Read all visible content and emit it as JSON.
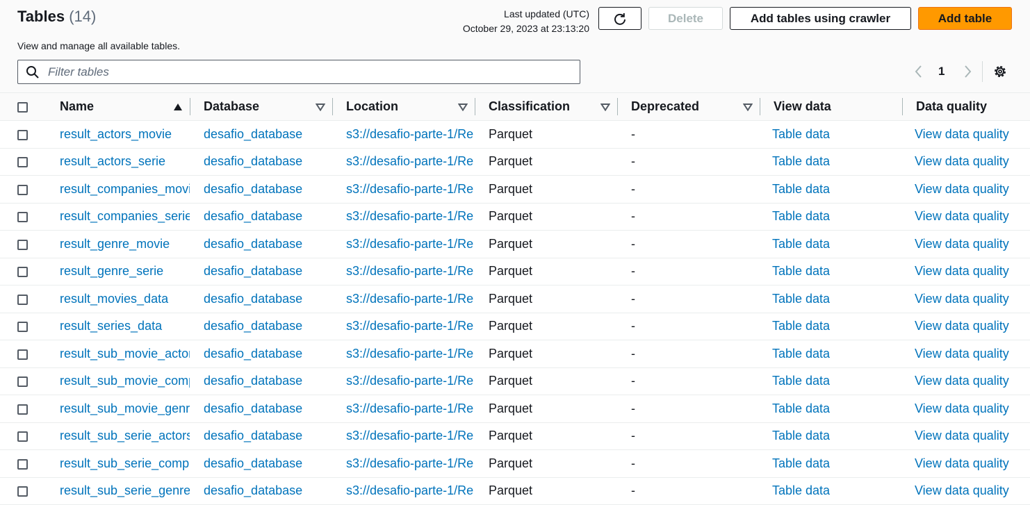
{
  "header": {
    "title": "Tables",
    "count": "(14)",
    "description": "View and manage all available tables.",
    "last_updated_label": "Last updated (UTC)",
    "last_updated_value": "October 29, 2023 at 23:13:20"
  },
  "toolbar": {
    "refresh_icon": "refresh-icon",
    "delete_label": "Delete",
    "crawler_label": "Add tables using crawler",
    "add_label": "Add table",
    "add_color": "#ff9900"
  },
  "search": {
    "placeholder": "Filter tables",
    "value": ""
  },
  "pagination": {
    "current_page": "1"
  },
  "columns": {
    "name": "Name",
    "database": "Database",
    "location": "Location",
    "classification": "Classification",
    "deprecated": "Deprecated",
    "view_data": "View data",
    "data_quality": "Data quality"
  },
  "rows": [
    {
      "name": "result_actors_movie",
      "database": "desafio_database",
      "location": "s3://desafio-parte-1/Re",
      "classification": "Parquet",
      "deprecated": "-",
      "view_data": "Table data",
      "data_quality": "View data quality"
    },
    {
      "name": "result_actors_serie",
      "database": "desafio_database",
      "location": "s3://desafio-parte-1/Re",
      "classification": "Parquet",
      "deprecated": "-",
      "view_data": "Table data",
      "data_quality": "View data quality"
    },
    {
      "name": "result_companies_movi",
      "database": "desafio_database",
      "location": "s3://desafio-parte-1/Re",
      "classification": "Parquet",
      "deprecated": "-",
      "view_data": "Table data",
      "data_quality": "View data quality"
    },
    {
      "name": "result_companies_serie",
      "database": "desafio_database",
      "location": "s3://desafio-parte-1/Re",
      "classification": "Parquet",
      "deprecated": "-",
      "view_data": "Table data",
      "data_quality": "View data quality"
    },
    {
      "name": "result_genre_movie",
      "database": "desafio_database",
      "location": "s3://desafio-parte-1/Re",
      "classification": "Parquet",
      "deprecated": "-",
      "view_data": "Table data",
      "data_quality": "View data quality"
    },
    {
      "name": "result_genre_serie",
      "database": "desafio_database",
      "location": "s3://desafio-parte-1/Re",
      "classification": "Parquet",
      "deprecated": "-",
      "view_data": "Table data",
      "data_quality": "View data quality"
    },
    {
      "name": "result_movies_data",
      "database": "desafio_database",
      "location": "s3://desafio-parte-1/Re",
      "classification": "Parquet",
      "deprecated": "-",
      "view_data": "Table data",
      "data_quality": "View data quality"
    },
    {
      "name": "result_series_data",
      "database": "desafio_database",
      "location": "s3://desafio-parte-1/Re",
      "classification": "Parquet",
      "deprecated": "-",
      "view_data": "Table data",
      "data_quality": "View data quality"
    },
    {
      "name": "result_sub_movie_actor",
      "database": "desafio_database",
      "location": "s3://desafio-parte-1/Re",
      "classification": "Parquet",
      "deprecated": "-",
      "view_data": "Table data",
      "data_quality": "View data quality"
    },
    {
      "name": "result_sub_movie_comp",
      "database": "desafio_database",
      "location": "s3://desafio-parte-1/Re",
      "classification": "Parquet",
      "deprecated": "-",
      "view_data": "Table data",
      "data_quality": "View data quality"
    },
    {
      "name": "result_sub_movie_genr",
      "database": "desafio_database",
      "location": "s3://desafio-parte-1/Re",
      "classification": "Parquet",
      "deprecated": "-",
      "view_data": "Table data",
      "data_quality": "View data quality"
    },
    {
      "name": "result_sub_serie_actors",
      "database": "desafio_database",
      "location": "s3://desafio-parte-1/Re",
      "classification": "Parquet",
      "deprecated": "-",
      "view_data": "Table data",
      "data_quality": "View data quality"
    },
    {
      "name": "result_sub_serie_compa",
      "database": "desafio_database",
      "location": "s3://desafio-parte-1/Re",
      "classification": "Parquet",
      "deprecated": "-",
      "view_data": "Table data",
      "data_quality": "View data quality"
    },
    {
      "name": "result_sub_serie_genres",
      "database": "desafio_database",
      "location": "s3://desafio-parte-1/Re",
      "classification": "Parquet",
      "deprecated": "-",
      "view_data": "Table data",
      "data_quality": "View data quality"
    }
  ]
}
